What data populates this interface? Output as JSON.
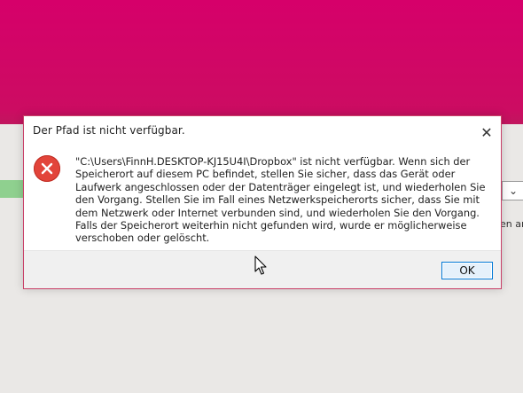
{
  "dialog": {
    "title": "Der Pfad ist nicht verfügbar.",
    "message": "\"C:\\Users\\FinnH.DESKTOP-KJ15U4I\\Dropbox\" ist nicht verfügbar. Wenn sich der Speicherort auf diesem PC befindet, stellen Sie sicher, dass das Gerät oder Laufwerk angeschlossen oder der Datenträger eingelegt ist, und wiederholen Sie den Vorgang. Stellen Sie im Fall eines Netzwerkspeicherorts sicher, dass Sie mit dem Netzwerk oder Internet verbunden sind, und wiederholen Sie den Vorgang. Falls der Speicherort weiterhin nicht gefunden wird, wurde er möglicherweise verschoben oder gelöscht.",
    "ok_label": "OK",
    "close_icon": "close-icon",
    "status_icon": "error-icon"
  },
  "background": {
    "dropdown_icon": "chevron-down-icon",
    "partial_text": "en an"
  },
  "colors": {
    "desktop_accent": "#d6006a",
    "error_red": "#e2443a",
    "button_border": "#0078d7"
  }
}
